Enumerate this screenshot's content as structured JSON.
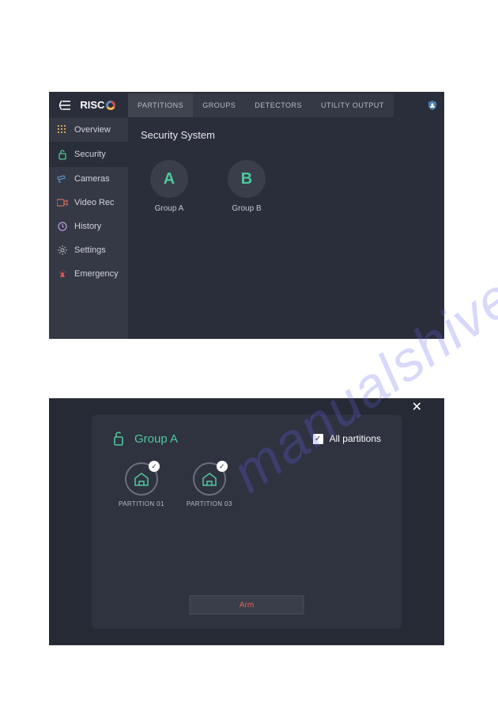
{
  "watermark": "manualshive.com",
  "app1": {
    "logo": "RISC",
    "tabs": [
      {
        "label": "PARTITIONS",
        "active": true
      },
      {
        "label": "GROUPS",
        "active": false
      },
      {
        "label": "DETECTORS",
        "active": false
      },
      {
        "label": "UTILITY OUTPUT",
        "active": false
      }
    ],
    "sidebar": [
      {
        "icon": "grid-icon",
        "label": "Overview",
        "color": "#d4a44a"
      },
      {
        "icon": "lock-icon",
        "label": "Security",
        "color": "#4ec999",
        "active": true
      },
      {
        "icon": "camera-icon",
        "label": "Cameras",
        "color": "#5c8ec0"
      },
      {
        "icon": "video-icon",
        "label": "Video Rec",
        "color": "#c96a5c"
      },
      {
        "icon": "clock-icon",
        "label": "History",
        "color": "#b8a0d8"
      },
      {
        "icon": "gear-icon",
        "label": "Settings",
        "color": "#a8abb5"
      },
      {
        "icon": "alarm-icon",
        "label": "Emergency",
        "color": "#e0514a"
      }
    ],
    "subtitle": "Security System",
    "groups": [
      {
        "letter": "A",
        "label": "Group A"
      },
      {
        "letter": "B",
        "label": "Group B"
      }
    ]
  },
  "app2": {
    "title": "Group A",
    "all_label": "All partitions",
    "all_checked": true,
    "partitions": [
      {
        "label": "PARTITION 01",
        "checked": true
      },
      {
        "label": "PARTITION 03",
        "checked": true
      }
    ],
    "arm_label": "Arm"
  }
}
